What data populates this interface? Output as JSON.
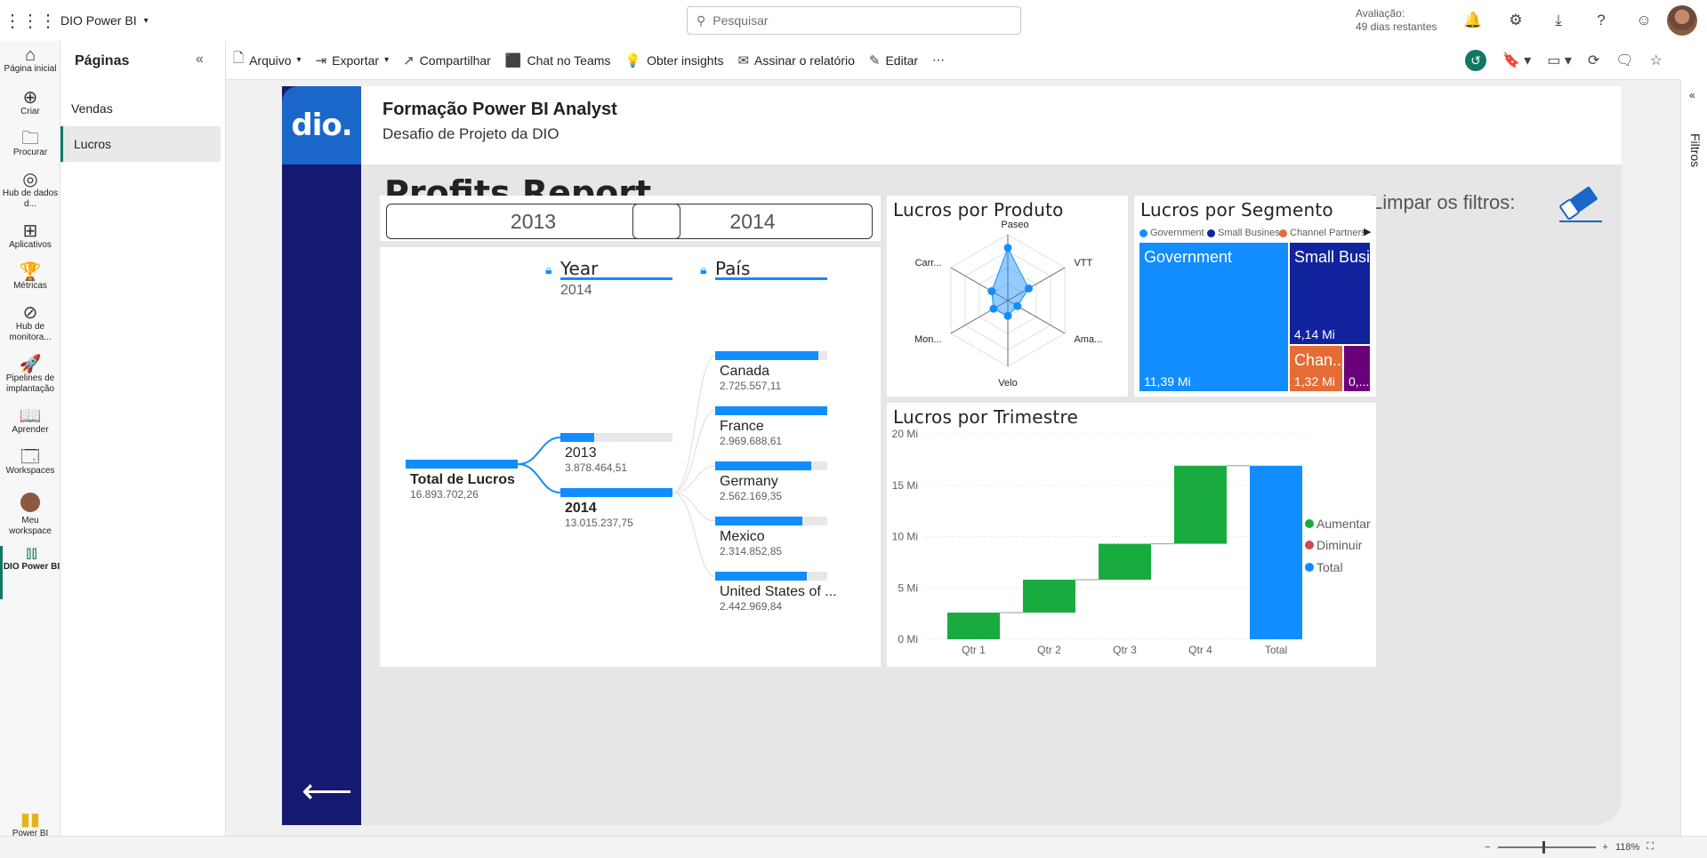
{
  "app": {
    "name": "DIO Power BI",
    "search_placeholder": "Pesquisar",
    "trial_label": "Avaliação:",
    "trial_days": "49 dias restantes"
  },
  "nav": {
    "home": "Página inicial",
    "create": "Criar",
    "browse": "Procurar",
    "datahub": "Hub de dados d...",
    "apps": "Aplicativos",
    "metrics": "Métricas",
    "monitor": "Hub de monitora...",
    "pipelines": "Pipelines de implantação",
    "learn": "Aprender",
    "workspaces": "Workspaces",
    "myworkspace": "Meu workspace",
    "current": "DIO Power BI",
    "brand": "Power BI"
  },
  "pages": {
    "title": "Páginas",
    "items": [
      "Vendas",
      "Lucros"
    ]
  },
  "toolbar": {
    "file": "Arquivo",
    "export": "Exportar",
    "share": "Compartilhar",
    "teams": "Chat no Teams",
    "insights": "Obter insights",
    "subscribe": "Assinar o relatório",
    "edit": "Editar",
    "more": "⋯"
  },
  "filters_label": "Filtros",
  "zoom_level": "118%",
  "report": {
    "logo": "dio.",
    "title": "Formação Power BI Analyst",
    "subtitle": "Desafio de Projeto da DIO",
    "page_title": "Profits Report",
    "clear_filters": "Limpar os filtros:",
    "year_slicer": [
      "2013",
      "2014"
    ],
    "decomp": {
      "root_label": "Total de Lucros",
      "root_value": "16.893.702,26",
      "level1_header": "Year",
      "level1_sub": "2014",
      "level2_header": "País",
      "years": [
        {
          "label": "2013",
          "value": "3.878.464,51",
          "fraction": 0.3
        },
        {
          "label": "2014",
          "value": "13.015.237,75",
          "fraction": 1.0
        }
      ],
      "countries": [
        {
          "label": "Canada",
          "value": "2.725.557,11",
          "fraction": 0.92
        },
        {
          "label": "France",
          "value": "2.969.688,61",
          "fraction": 1.0
        },
        {
          "label": "Germany",
          "value": "2.562.169,35",
          "fraction": 0.86
        },
        {
          "label": "Mexico",
          "value": "2.314.852,85",
          "fraction": 0.78
        },
        {
          "label": "United States of ...",
          "value": "2.442.969,84",
          "fraction": 0.82
        }
      ]
    },
    "radar": {
      "title": "Lucros por Produto",
      "axes": [
        "Paseo",
        "VTT",
        "Ama...",
        "Velo",
        "Mon...",
        "Carr..."
      ]
    },
    "segment": {
      "title": "Lucros por Segmento",
      "legend": [
        {
          "name": "Government",
          "color": "#118dff"
        },
        {
          "name": "Small Business",
          "color": "#12239e"
        },
        {
          "name": "Channel Partners",
          "color": "#e66c37"
        }
      ],
      "tiles": [
        {
          "name": "Government",
          "value": "11,39 Mi",
          "color": "#118dff"
        },
        {
          "name": "Small Busi...",
          "value": "4,14 Mi",
          "color": "#12239e"
        },
        {
          "name": "Chan...",
          "value": "1,32 Mi",
          "color": "#e66c37"
        },
        {
          "name": "0,...",
          "value": "",
          "color": "#6b007b"
        }
      ]
    },
    "quarter": {
      "title": "Lucros por Trimestre",
      "legend": [
        {
          "name": "Aumentar",
          "color": "#1aab40"
        },
        {
          "name": "Diminuir",
          "color": "#d64550"
        },
        {
          "name": "Total",
          "color": "#118dff"
        }
      ]
    }
  },
  "chart_data": [
    {
      "type": "radar",
      "title": "Lucros por Produto",
      "categories": [
        "Paseo",
        "VTT",
        "Ama...",
        "Velo",
        "Mon...",
        "Carr..."
      ],
      "values": [
        4.8,
        2.2,
        1.0,
        1.4,
        1.5,
        1.7
      ],
      "rmax": 6
    },
    {
      "type": "waterfall",
      "title": "Lucros por Trimestre",
      "categories": [
        "Qtr 1",
        "Qtr 2",
        "Qtr 3",
        "Qtr 4",
        "Total"
      ],
      "values": [
        2.6,
        3.2,
        3.5,
        7.6,
        16.9
      ],
      "kinds": [
        "increase",
        "increase",
        "increase",
        "increase",
        "total"
      ],
      "ylim": [
        0,
        20
      ],
      "yticks": [
        "0 Mi",
        "5 Mi",
        "10 Mi",
        "15 Mi",
        "20 Mi"
      ],
      "colors": {
        "increase": "#1aab40",
        "decrease": "#d64550",
        "total": "#118dff"
      }
    }
  ]
}
